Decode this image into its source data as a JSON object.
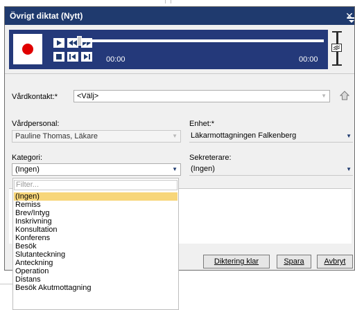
{
  "window": {
    "title": "Övrigt diktat (Nytt)",
    "close_glyph": "✕"
  },
  "player": {
    "time_start": "00:00",
    "time_end": "00:00",
    "progress": 0,
    "icons": [
      "record-icon",
      "play-icon",
      "rewind-icon",
      "fast-forward-icon",
      "stop-icon",
      "skip-start-icon",
      "skip-end-icon"
    ]
  },
  "form": {
    "vardkontakt": {
      "label": "Vårdkontakt:*",
      "value": "<Välj>"
    },
    "vardpersonal": {
      "label": "Vårdpersonal:",
      "value": "Pauline Thomas, Läkare"
    },
    "enhet": {
      "label": "Enhet:*",
      "value": "Läkarmottagningen Falkenberg"
    },
    "kategori": {
      "label": "Kategori:",
      "value": "(Ingen)"
    },
    "sekreterare": {
      "label": "Sekreterare:",
      "value": "(Ingen)"
    }
  },
  "buttons": {
    "diktering_klar": "Diktering klar",
    "spara": "Spara",
    "avbryt": "Avbryt"
  },
  "dropdown": {
    "filter_placeholder": "Filter...",
    "selected_index": 0,
    "options": [
      "(Ingen)",
      "Remiss",
      "Brev/Intyg",
      "Inskrivning",
      "Konsultation",
      "Konferens",
      "Besök",
      "Slutanteckning",
      "Anteckning",
      "Operation",
      "Distans",
      "Besök Akutmottagning"
    ]
  },
  "colors": {
    "titlebar": "#1f3a6e",
    "player": "#24397a",
    "record": "#e00000",
    "highlight": "#f7d67a"
  }
}
